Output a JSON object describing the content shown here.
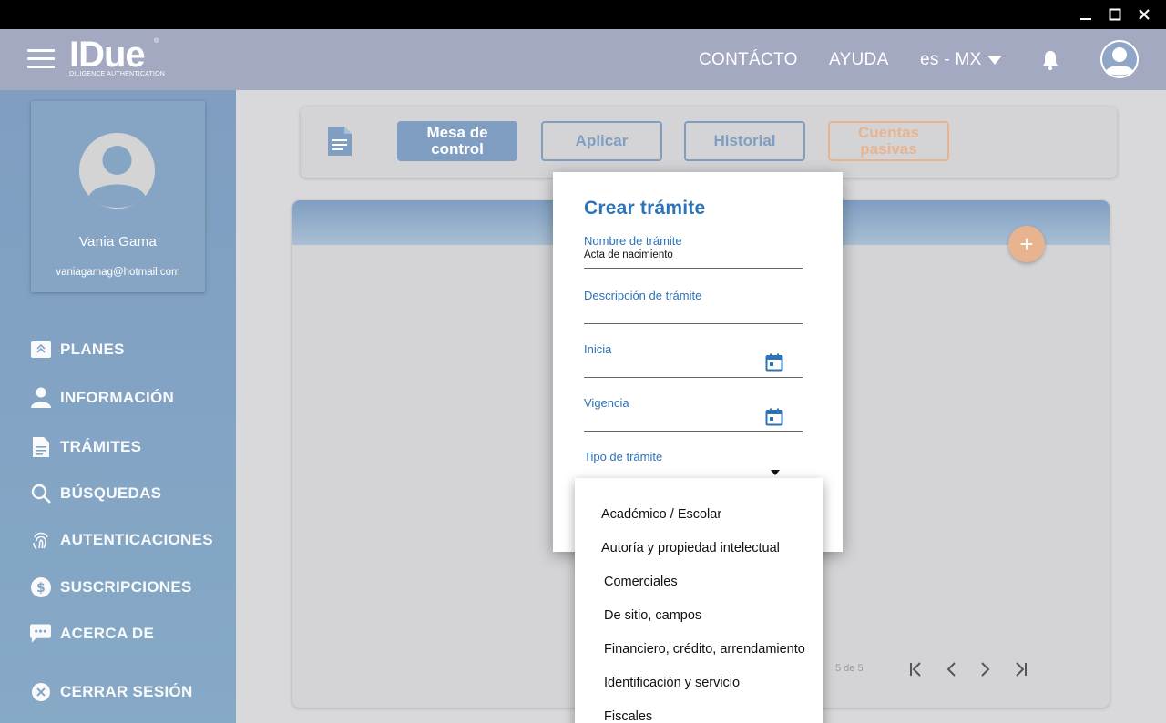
{
  "window": {
    "controls": [
      "minimize",
      "maximize",
      "close"
    ]
  },
  "header": {
    "logo_main": "IDue",
    "logo_reg": "®",
    "logo_sub": "DILIGENCE AUTHENTICATION",
    "nav": {
      "contacto": "CONTÁCTO",
      "ayuda": "AYUDA",
      "language": "es - MX"
    }
  },
  "profile": {
    "name": "Vania Gama",
    "email": "vaniagamag@hotmail.com"
  },
  "sidebar": {
    "items": [
      {
        "label": "PLANES",
        "icon": "plans-icon"
      },
      {
        "label": "INFORMACIÓN",
        "icon": "person-icon"
      },
      {
        "label": "TRÁMITES",
        "icon": "document-icon"
      },
      {
        "label": "BÚSQUEDAS",
        "icon": "search-icon"
      },
      {
        "label": "AUTENTICACIONES",
        "icon": "fingerprint-icon"
      },
      {
        "label": "SUSCRIPCIONES",
        "icon": "dollar-icon"
      },
      {
        "label": "ACERCA DE",
        "icon": "chat-icon"
      },
      {
        "label": "CERRAR SESIÓN",
        "icon": "close-circle-icon"
      }
    ]
  },
  "toolbar": {
    "mesa_line1": "Mesa de",
    "mesa_line2": "control",
    "aplicar": "Aplicar",
    "historial": "Historial",
    "cuentas_line1": "Cuentas",
    "cuentas_line2": "pasivas"
  },
  "list": {
    "pager_text": "5 de 5",
    "fab": "+"
  },
  "modal": {
    "title": "Crear trámite",
    "fields": {
      "nombre_label": "Nombre de trámite",
      "nombre_value": "Acta de nacimiento",
      "descripcion_label": "Descripción de trámite",
      "inicia_label": "Inicia",
      "vigencia_label": "Vigencia",
      "tipo_label": "Tipo de trámite"
    }
  },
  "dropdown": {
    "options": [
      "Académico / Escolar",
      "Autoría y propiedad intelectual",
      "Comerciales",
      "De sitio, campos",
      "Financiero, crédito, arrendamiento",
      "Identificación y servicio",
      "Fiscales"
    ]
  },
  "colors": {
    "header": "#a4a9c2",
    "sidebar": "#7f9ec2",
    "accent_blue": "#2d73b8",
    "accent_orange": "#e8b48f"
  }
}
